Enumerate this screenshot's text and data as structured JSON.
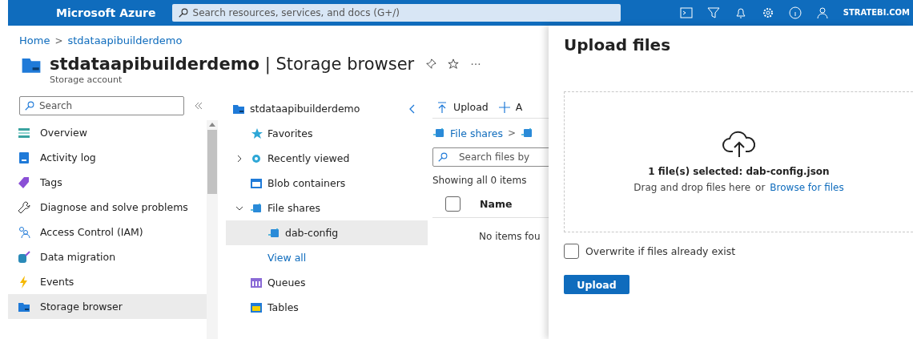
{
  "topbar": {
    "brand": "Microsoft Azure",
    "search_placeholder": "Search resources, services, and docs (G+/)",
    "account": "STRATEBI.COM"
  },
  "breadcrumb": {
    "items": [
      "Home",
      "stdataapibuilderdemo"
    ],
    "separator": ">"
  },
  "header": {
    "title": "**stdataapibuilderdemo** | Storage browser",
    "subtitle": "Storage account"
  },
  "sidebar": {
    "search_placeholder": "Search",
    "items": [
      {
        "label": "Overview",
        "selected": false
      },
      {
        "label": "Activity log",
        "selected": false
      },
      {
        "label": "Tags",
        "selected": false
      },
      {
        "label": "Diagnose and solve problems",
        "selected": false
      },
      {
        "label": "Access Control (IAM)",
        "selected": false
      },
      {
        "label": "Data migration",
        "selected": false
      },
      {
        "label": "Events",
        "selected": false
      },
      {
        "label": "Storage browser",
        "selected": true
      }
    ]
  },
  "tree": {
    "root": "stdataapibuilderdemo",
    "items": [
      {
        "label": "Favorites",
        "kind": "node",
        "selected": false
      },
      {
        "label": "Recently viewed",
        "kind": "node",
        "expanded": false,
        "selected": false
      },
      {
        "label": "Blob containers",
        "kind": "node",
        "selected": false
      },
      {
        "label": "File shares",
        "kind": "node",
        "expanded": true,
        "selected": false,
        "children": [
          {
            "label": "dab-config",
            "kind": "node",
            "selected": true
          },
          {
            "label": "View all",
            "kind": "link",
            "selected": false
          }
        ]
      },
      {
        "label": "Queues",
        "kind": "node",
        "selected": false
      },
      {
        "label": "Tables",
        "kind": "node",
        "selected": false
      }
    ]
  },
  "content": {
    "toolbar": [
      "Upload",
      "A"
    ],
    "path": [
      "File shares"
    ],
    "path_separator": ">",
    "search_placeholder": "Search files by",
    "count": "Showing all 0 items",
    "select_all_checked": false,
    "column": "Name",
    "empty": "No items fou"
  },
  "panel": {
    "title": "Upload files",
    "selected_text": "1 file(s) selected: dab-config.json",
    "drop_text": "Drag and drop files here",
    "or": "or",
    "browse": "Browse for files",
    "overwrite": {
      "label": "Overwrite if files already exist",
      "checked": false
    },
    "button": "Upload"
  }
}
